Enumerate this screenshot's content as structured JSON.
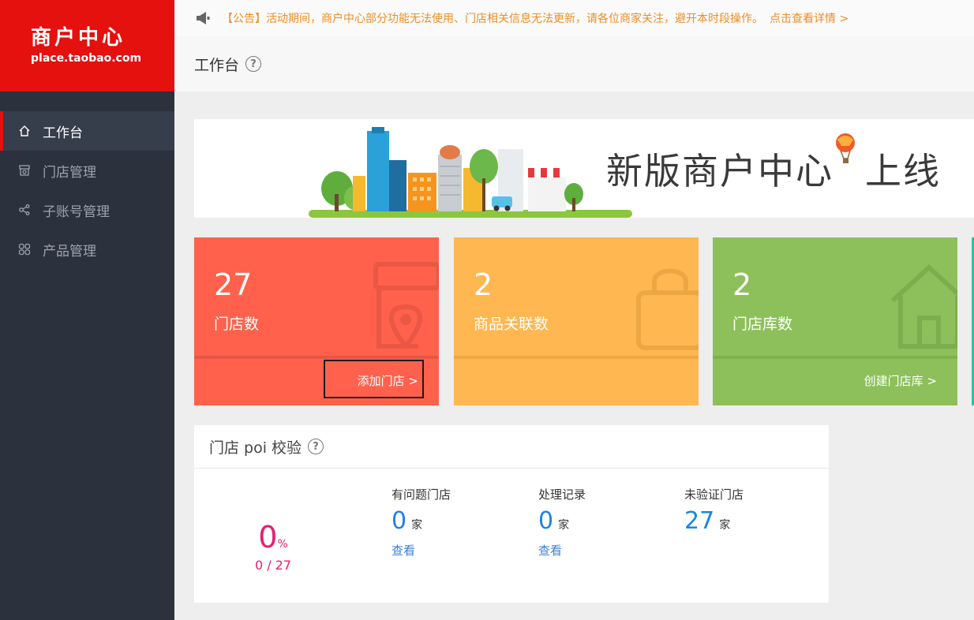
{
  "sidebar": {
    "logo_title": "商户中心",
    "logo_sub": "place.taobao.com",
    "items": [
      {
        "label": "工作台",
        "icon": "home-icon"
      },
      {
        "label": "门店管理",
        "icon": "store-icon"
      },
      {
        "label": "子账号管理",
        "icon": "share-icon"
      },
      {
        "label": "产品管理",
        "icon": "grid-icon"
      }
    ]
  },
  "notice": {
    "text": "【公告】活动期间，商户中心部分功能无法使用、门店相关信息无法更新，请各位商家关注，避开本时段操作。",
    "more": "点击查看详情 >"
  },
  "header": {
    "title": "工作台",
    "help": "?"
  },
  "banner": {
    "text_main": "新版商户中心",
    "text_end": "上线"
  },
  "cards": [
    {
      "value": "27",
      "label": "门店数",
      "action": "添加门店 >",
      "color": "#ff614c"
    },
    {
      "value": "2",
      "label": "商品关联数",
      "action": "",
      "color": "#ffb751"
    },
    {
      "value": "2",
      "label": "门店库数",
      "action": "创建门店库 >",
      "color": "#8dc05b"
    }
  ],
  "poi": {
    "title": "门店 poi 校验",
    "help": "?",
    "percent_value": "0",
    "percent_sign": "%",
    "fraction": "0 / 27",
    "columns": [
      {
        "title": "有问题门店",
        "value": "0",
        "unit": "家",
        "link": "查看"
      },
      {
        "title": "处理记录",
        "value": "0",
        "unit": "家",
        "link": "查看"
      },
      {
        "title": "未验证门店",
        "value": "27",
        "unit": "家",
        "link": ""
      }
    ]
  },
  "colors": {
    "brand_red": "#e4110e",
    "sidebar_bg": "#2b313d",
    "notice_orange": "#ef8d22",
    "poi_pink": "#ec1c72",
    "link_blue": "#1e82e6"
  }
}
